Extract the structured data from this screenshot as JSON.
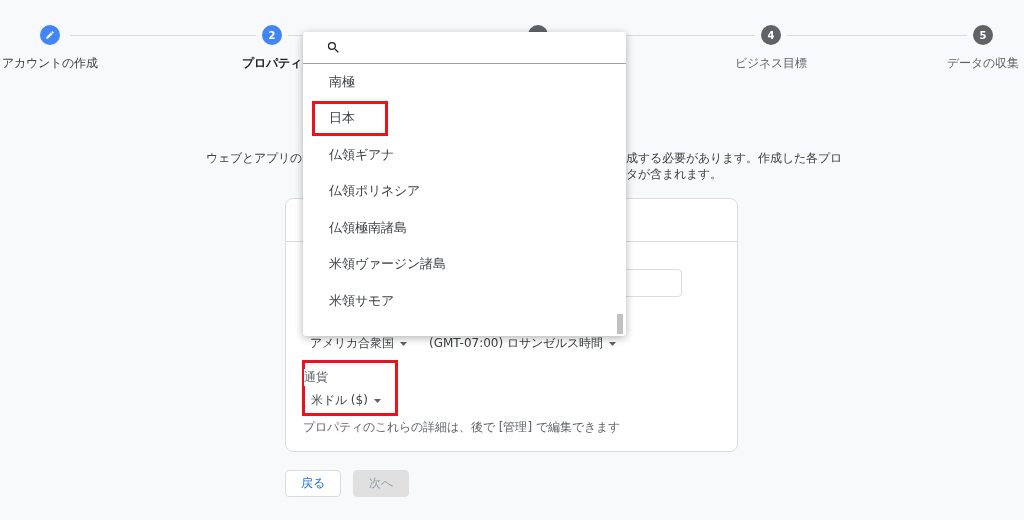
{
  "steps": [
    {
      "label": "アカウントの作成",
      "done": true,
      "selected": false
    },
    {
      "number": "2",
      "label": "プロパティ",
      "done": false,
      "selected": true
    },
    {
      "done": false,
      "selected": false
    },
    {
      "number": "4",
      "label": "ビジネス目標",
      "done": false,
      "selected": false
    },
    {
      "number": "5",
      "label": "データの収集",
      "done": false,
      "selected": false
    }
  ],
  "description": {
    "left": "ウェブとアプリの",
    "right_lines": [
      "成する必要があります。作成した各プロ",
      "タが含まれます。"
    ]
  },
  "card": {
    "selects": [
      {
        "value": "アメリカ合衆国"
      },
      {
        "value": "(GMT-07:00) ロサンゼルス時間"
      }
    ],
    "currency": {
      "label": "通貨",
      "value": "米ドル ($)",
      "highlighted": true
    },
    "hint": "プロパティのこれらの詳細は、後で [管理] で編集できます"
  },
  "buttons": [
    {
      "label": "戻る",
      "disabled": false
    },
    {
      "label": "次へ",
      "disabled": true
    }
  ],
  "dropdown": {
    "items": [
      {
        "label": "南極",
        "highlighted": false
      },
      {
        "label": "日本",
        "highlighted": true
      },
      {
        "label": "仏領ギアナ",
        "highlighted": false
      },
      {
        "label": "仏領ポリネシア",
        "highlighted": false
      },
      {
        "label": "仏領極南諸島",
        "highlighted": false
      },
      {
        "label": "米領ヴァージン諸島",
        "highlighted": false
      },
      {
        "label": "米領サモア",
        "highlighted": false
      }
    ]
  }
}
